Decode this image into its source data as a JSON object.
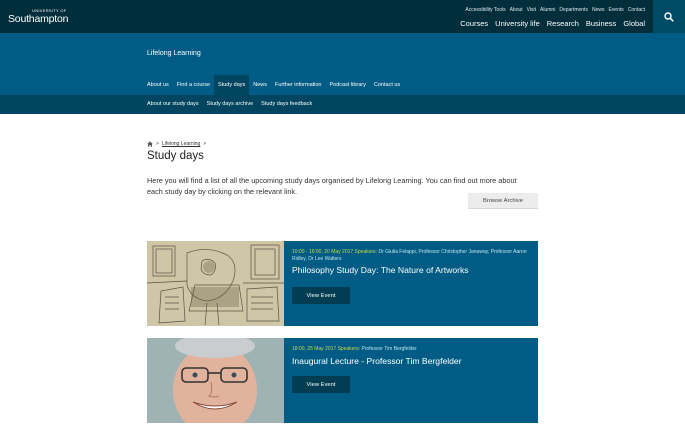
{
  "header": {
    "logo_small": "UNIVERSITY OF",
    "logo_big": "Southampton",
    "utility_links": [
      "Accessibility Tools",
      "About",
      "Visit",
      "Alumni",
      "Departments",
      "News",
      "Events",
      "Contact"
    ],
    "main_nav": [
      "Courses",
      "University life",
      "Research",
      "Business",
      "Global"
    ],
    "search_icon": "search-icon"
  },
  "site": {
    "title": "Lifelong Learning",
    "nav": [
      "About us",
      "Find a course",
      "Study days",
      "News",
      "Further information",
      "Podcast library",
      "Contact us"
    ],
    "active_nav": "Study days",
    "sub_nav": [
      "About our study days",
      "Study days archive",
      "Study days feedback"
    ]
  },
  "breadcrumb": {
    "home_icon": "home-icon",
    "sep": ">",
    "link": "Lifelong Learning"
  },
  "page": {
    "title": "Study days",
    "intro": "Here you will find a list of all the upcoming study days organised by Lifelong Learning. You can find out more about each study day by clicking on the relevant link.",
    "archive_button": "Browse Archive"
  },
  "events": [
    {
      "datetime": "10:00 - 16:00, 20 May 2017",
      "speakers_label": "Speakers:",
      "speakers": "Dr Giulia Felappi, Professor Christopher Janaway, Professor Aaron Ridley, Dr Lee Walters",
      "title": "Philosophy Study Day: The Nature of Artworks",
      "button": "View Event"
    },
    {
      "datetime": "18:00, 25 May 2017",
      "speakers_label": "Speakers:",
      "speakers": "Professor Tim Bergfelder",
      "title": "Inaugural Lecture - Professor Tim Bergfelder",
      "button": "View Event"
    }
  ],
  "colors": {
    "topbar": "#002e3b",
    "band": "#005c84",
    "band_dark": "#00455f",
    "accent_yellow": "#c9d94f"
  }
}
